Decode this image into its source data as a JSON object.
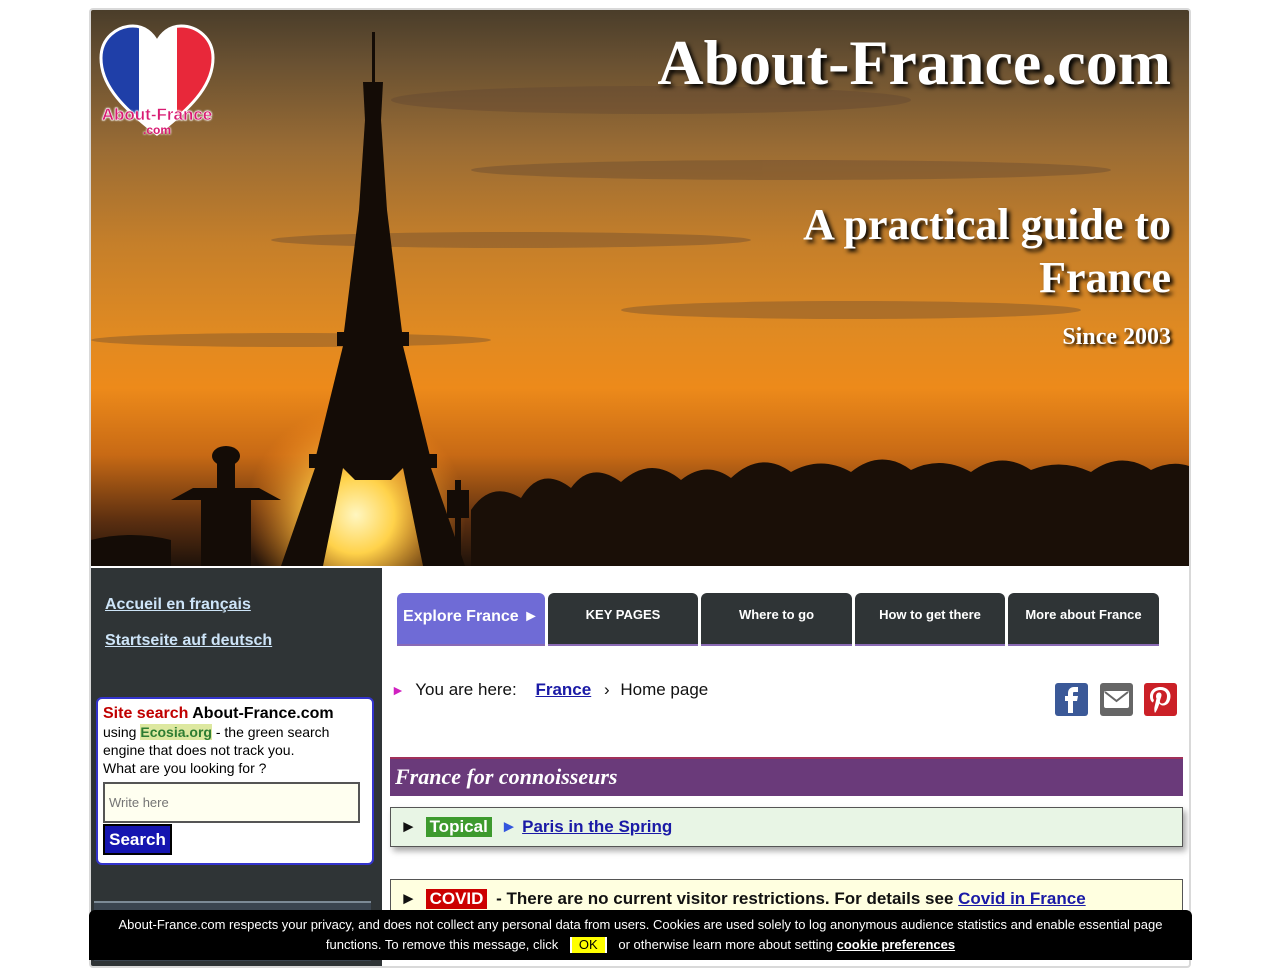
{
  "hero": {
    "site_title": "About-France.com",
    "tagline": "A practical guide to France",
    "since": "Since 2003",
    "logo_line1": "About-France",
    "logo_line2": ".com"
  },
  "sidebar": {
    "links": [
      {
        "label": "Accueil en français"
      },
      {
        "label": "Startseite auf deutsch"
      }
    ],
    "search": {
      "title_red": "Site search",
      "title_black": "About-France.com",
      "using": "using",
      "engine": "Ecosia.org",
      "desc_rest": "- the green search engine that does not track you.",
      "question": "What are you looking for ?",
      "placeholder": "Write here",
      "button": "Search"
    }
  },
  "tabs": [
    {
      "label": "Explore France ►"
    },
    {
      "label": "KEY PAGES"
    },
    {
      "label": "Where to go"
    },
    {
      "label": "How to get there"
    },
    {
      "label": "More about France"
    }
  ],
  "breadcrumb": {
    "arrow": "►",
    "prefix": "You are here:",
    "link": "France",
    "separator": "›",
    "current": "Home page"
  },
  "share": {
    "icons": [
      "facebook-icon",
      "email-icon",
      "pinterest-icon"
    ],
    "colors": {
      "facebook": "#3b5998",
      "email": "#666666",
      "pinterest": "#cb2027"
    }
  },
  "main": {
    "section_title": "France for connoisseurs",
    "topical": {
      "arrow": "►",
      "badge": "Topical",
      "arrow2": "►",
      "link": "Paris in the Spring"
    },
    "covid": {
      "arrow": "►",
      "badge": "COVID",
      "text": "- There are no current visitor restrictions. For details see",
      "link": "Covid in France"
    }
  },
  "cookie": {
    "text1": "About-France.com respects your privacy, and does not collect any personal data from users. Cookies are used solely to log anonymous audience statistics and enable essential page functions. To remove this message, click",
    "ok": "OK",
    "text2": "or otherwise learn more about setting",
    "link": "cookie preferences"
  }
}
